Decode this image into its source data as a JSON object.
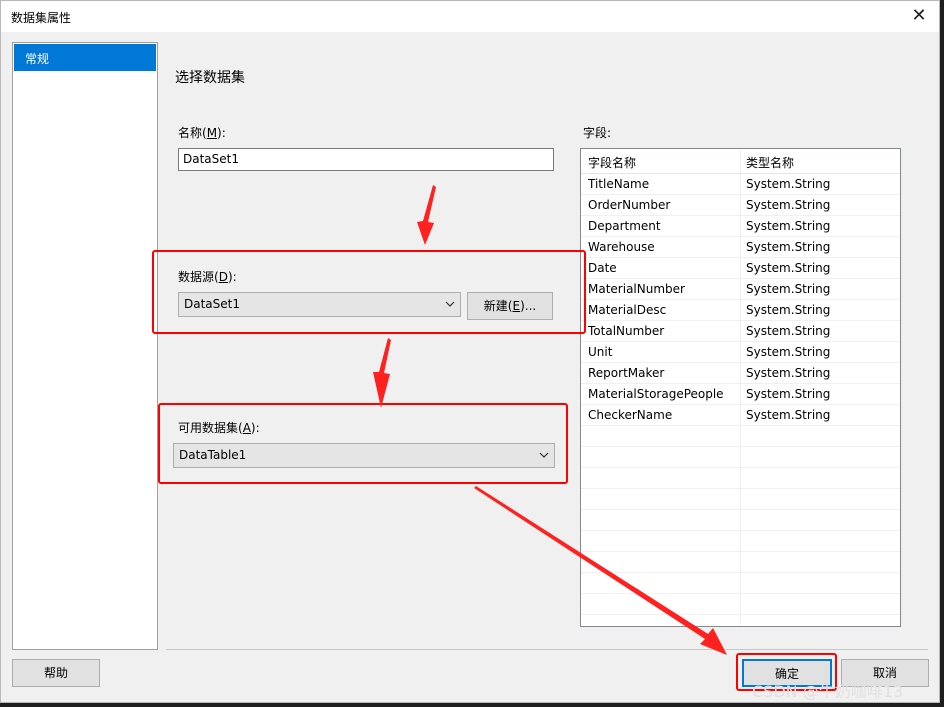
{
  "dialog": {
    "title": "数据集属性",
    "close_glyph": "✕"
  },
  "nav": {
    "items": [
      {
        "label": "常规"
      }
    ]
  },
  "content": {
    "section_title": "选择数据集",
    "name": {
      "label_pre": "名称(",
      "label_key": "M",
      "label_post": "):",
      "value": "DataSet1"
    },
    "data_source": {
      "label_pre": "数据源(",
      "label_key": "D",
      "label_post": "):",
      "value": "DataSet1",
      "new_pre": "新建(",
      "new_key": "E",
      "new_post": ")..."
    },
    "available": {
      "label_pre": "可用数据集(",
      "label_key": "A",
      "label_post": "):",
      "value": "DataTable1"
    },
    "fields": {
      "label": "字段:",
      "col_name": "字段名称",
      "col_type": "类型名称",
      "rows": [
        {
          "name": "TitleName",
          "type": "System.String"
        },
        {
          "name": "OrderNumber",
          "type": "System.String"
        },
        {
          "name": "Department",
          "type": "System.String"
        },
        {
          "name": "Warehouse",
          "type": "System.String"
        },
        {
          "name": "Date",
          "type": "System.String"
        },
        {
          "name": "MaterialNumber",
          "type": "System.String"
        },
        {
          "name": "MaterialDesc",
          "type": "System.String"
        },
        {
          "name": "TotalNumber",
          "type": "System.String"
        },
        {
          "name": "Unit",
          "type": "System.String"
        },
        {
          "name": "ReportMaker",
          "type": "System.String"
        },
        {
          "name": "MaterialStoragePeople",
          "type": "System.String"
        },
        {
          "name": "CheckerName",
          "type": "System.String"
        }
      ]
    }
  },
  "footer": {
    "help": "帮助",
    "ok": "确定",
    "cancel": "取消"
  },
  "watermark": "CSDN @牛奶咖啡13",
  "colors": {
    "annotation": "#ff0000",
    "selection": "#0078d7"
  }
}
